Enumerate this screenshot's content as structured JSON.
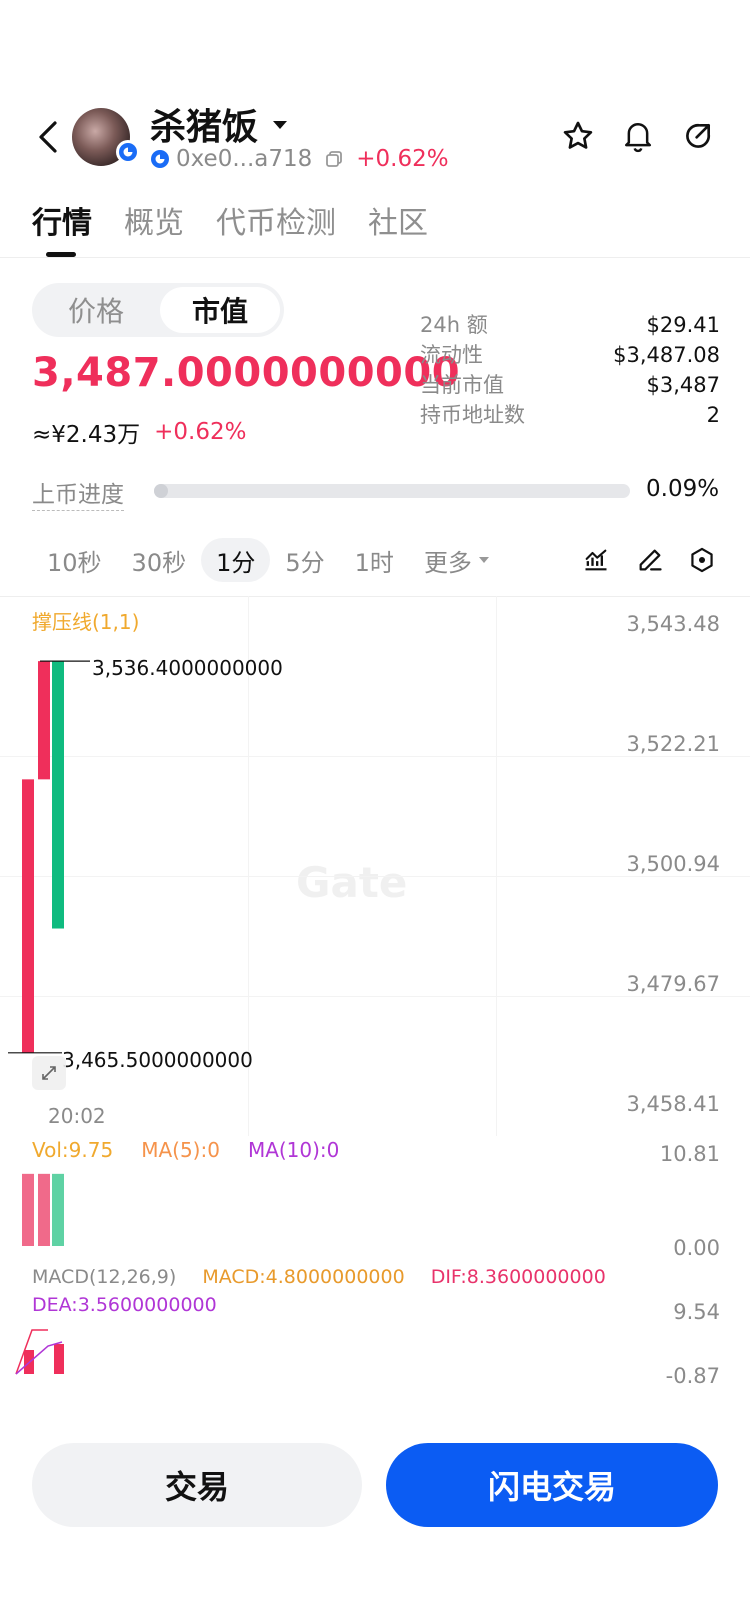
{
  "header": {
    "title": "杀猪饭",
    "address": "0xe0...a718",
    "change_pct": "+0.62%",
    "icons": {
      "back": "back-arrow-icon",
      "star": "star-icon",
      "bell": "bell-icon",
      "share": "share-icon",
      "copy": "copy-icon",
      "verified": "chain-badge-icon",
      "caret": "caret-down-icon"
    }
  },
  "tabs": [
    "行情",
    "概览",
    "代币检测",
    "社区"
  ],
  "segment": {
    "options": [
      "价格",
      "市值"
    ],
    "selected": "市值"
  },
  "price": {
    "main": "3,487.0000000000",
    "cny": "≈¥2.43万",
    "change": "+0.62%"
  },
  "stats": [
    {
      "label": "24h  额",
      "value": "$29.41"
    },
    {
      "label": "流动性",
      "value": "$3,487.08"
    },
    {
      "label": "当前市值",
      "value": "$3,487"
    },
    {
      "label": "持币地址数",
      "value": "2"
    }
  ],
  "progress": {
    "label": "上币进度",
    "value": "0.09%",
    "fraction": 0.0009
  },
  "intervals": {
    "items": [
      "10秒",
      "30秒",
      "1分",
      "5分",
      "1时",
      "更多"
    ],
    "selected": "1分"
  },
  "chart_data": {
    "type": "candlestick",
    "indicator_label": "撑压线(1,1)",
    "y_axis_ticks": [
      "3,543.48",
      "3,522.21",
      "3,500.94",
      "3,479.67",
      "3,458.41"
    ],
    "ylim": [
      3458.41,
      3543.48
    ],
    "x_tick": "20:02",
    "high_label": "3,536.4000000000",
    "low_label": "3,465.5000000000",
    "candles": [
      {
        "open": 3465.5,
        "close": 3515.0,
        "high": 3515.0,
        "low": 3465.5,
        "color": "#ef2f5b"
      },
      {
        "open": 3515.0,
        "close": 3536.4,
        "high": 3536.4,
        "low": 3515.0,
        "color": "#ef2f5b"
      },
      {
        "open": 3536.4,
        "close": 3488.0,
        "high": 3536.4,
        "low": 3488.0,
        "color": "#0fbb7f"
      }
    ],
    "volume": {
      "labels": {
        "vol": "Vol:9.75",
        "ma5": "MA(5):0",
        "ma10": "MA(10):0"
      },
      "axis": [
        "10.81",
        "0.00"
      ],
      "ylim": [
        0,
        10.81
      ],
      "values": [
        9.75,
        9.75,
        9.75
      ],
      "colors": [
        "#f06a8a",
        "#f06a8a",
        "#5fd2a4"
      ]
    },
    "macd": {
      "labels": {
        "name": "MACD(12,26,9)",
        "macd": "MACD:4.8000000000",
        "dif": "DIF:8.3600000000",
        "dea": "DEA:3.5600000000"
      },
      "axis": [
        "9.54",
        "-0.87"
      ]
    }
  },
  "watermark": "Gate",
  "buttons": {
    "trade": "交易",
    "flash": "闪电交易"
  }
}
